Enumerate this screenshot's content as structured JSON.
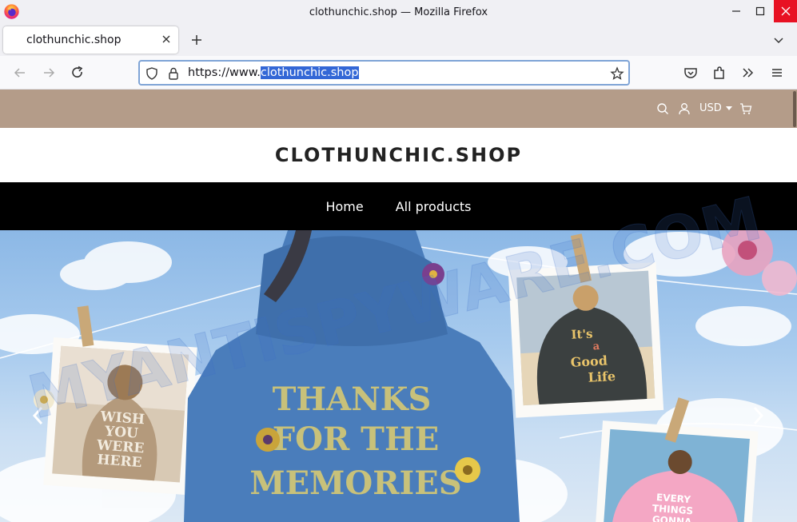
{
  "window": {
    "title": "clothunchic.shop — Mozilla Firefox"
  },
  "tabs": [
    {
      "label": "clothunchic.shop",
      "active": true
    }
  ],
  "urlbar": {
    "prefix": "https://www.",
    "selected": "clothunchic.shop"
  },
  "site": {
    "logo": "CLOTHUNCHIC.SHOP",
    "currency": "USD",
    "nav": [
      {
        "label": "Home"
      },
      {
        "label": "All products"
      }
    ],
    "topbar_color": "#b49c89"
  },
  "hero": {
    "hoodie_text": [
      "THANKS",
      "FOR THE",
      "MEMORIES"
    ],
    "photo_left_text": [
      "WISH",
      "YOU",
      "WERE",
      "HERE"
    ],
    "photo_right_text": [
      "It's",
      "a",
      "Good",
      "Life"
    ],
    "photo_bottom_text": [
      "EVERY",
      "THINGS",
      "GONNA"
    ]
  },
  "watermark": "MYANTISPYWARE.COM",
  "icons": {
    "back": "back-arrow-icon",
    "forward": "forward-arrow-icon",
    "reload": "reload-icon",
    "shield": "tracking-shield-icon",
    "lock": "lock-icon",
    "bookmark": "star-icon",
    "pocket": "pocket-icon",
    "extensions": "extensions-icon",
    "overflow": "overflow-chevrons-icon",
    "menu": "hamburger-menu-icon"
  }
}
